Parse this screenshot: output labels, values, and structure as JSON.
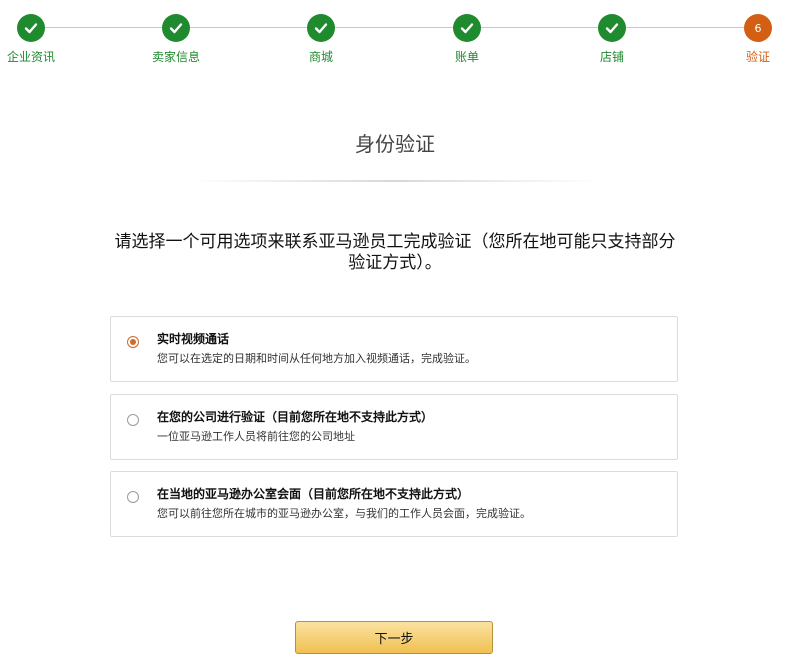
{
  "colors": {
    "step_done": "#1f8a2e",
    "step_current": "#d35f14",
    "radio_selected": "#d0692c",
    "button_top": "#fbe2a0",
    "button_bottom": "#f0c052"
  },
  "steps": [
    {
      "label": "企业资讯",
      "state": "done",
      "icon": "check-icon"
    },
    {
      "label": "卖家信息",
      "state": "done",
      "icon": "check-icon"
    },
    {
      "label": "商城",
      "state": "done",
      "icon": "check-icon"
    },
    {
      "label": "账单",
      "state": "done",
      "icon": "check-icon"
    },
    {
      "label": "店铺",
      "state": "done",
      "icon": "check-icon"
    },
    {
      "label": "验证",
      "state": "current",
      "number": "6"
    }
  ],
  "page": {
    "title": "身份验证",
    "instruction": "请选择一个可用选项来联系亚马逊员工完成验证（您所在地可能只支持部分验证方式）。"
  },
  "options": [
    {
      "title": "实时视频通话",
      "description": "您可以在选定的日期和时间从任何地方加入视频通话，完成验证。",
      "selected": true
    },
    {
      "title": "在您的公司进行验证（目前您所在地不支持此方式）",
      "description": "一位亚马逊工作人员将前往您的公司地址",
      "selected": false
    },
    {
      "title": "在当地的亚马逊办公室会面（目前您所在地不支持此方式）",
      "description": "您可以前往您所在城市的亚马逊办公室，与我们的工作人员会面，完成验证。",
      "selected": false
    }
  ],
  "next_button": {
    "label": "下一步"
  }
}
